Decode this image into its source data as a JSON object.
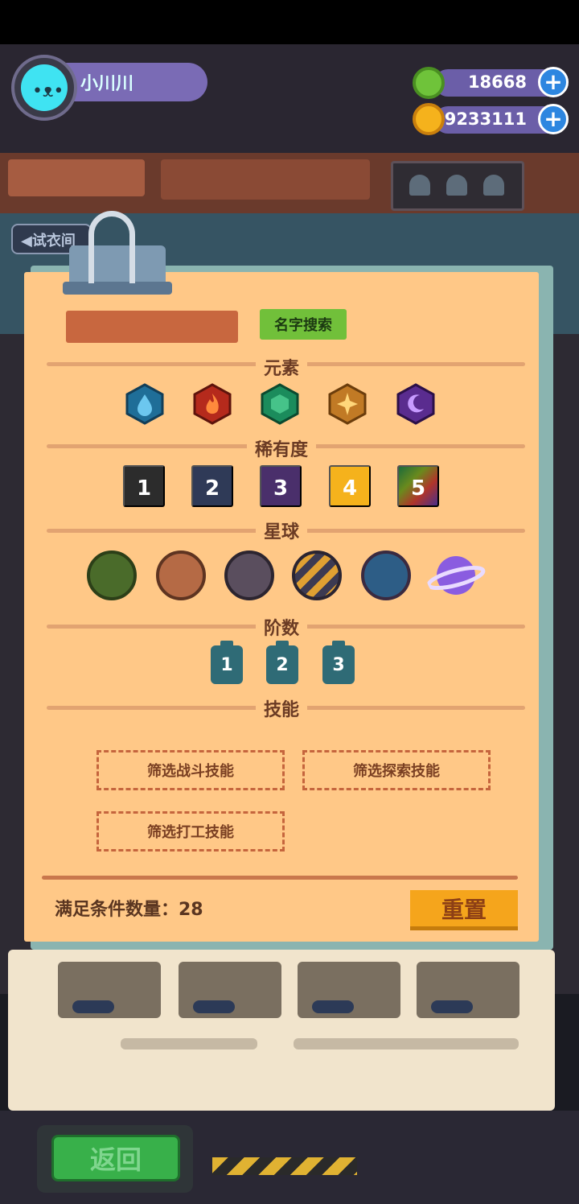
{
  "header": {
    "username": "小川川",
    "currency_green": "18668",
    "currency_gold": "9233111",
    "add_label": "+"
  },
  "trial_tab": {
    "label": "◀试衣间"
  },
  "filter_panel": {
    "search_button": "名字搜索",
    "sections": {
      "element": "元素",
      "rarity": "稀有度",
      "planet": "星球",
      "stage": "阶数",
      "skill": "技能"
    },
    "elements": [
      {
        "icon": "water-icon",
        "color": "#1f6e98"
      },
      {
        "icon": "fire-icon",
        "color": "#b52a1c"
      },
      {
        "icon": "earth-icon",
        "color": "#1b8c5c"
      },
      {
        "icon": "light-icon",
        "color": "#c17a25"
      },
      {
        "icon": "dark-icon",
        "color": "#5a2c8f"
      }
    ],
    "rarities": [
      "1",
      "2",
      "3",
      "4",
      "5"
    ],
    "rarity_colors": [
      "#2c2c2c",
      "#2f3a57",
      "#4a2f6b",
      "#f5b21c",
      "rainbow"
    ],
    "planets": [
      {
        "icon": "planet-green-icon"
      },
      {
        "icon": "planet-cookie-icon"
      },
      {
        "icon": "planet-machine-icon"
      },
      {
        "icon": "planet-striped-icon"
      },
      {
        "icon": "planet-blue-icon"
      },
      {
        "icon": "planet-purple-ringed-icon"
      }
    ],
    "stages": [
      "1",
      "2",
      "3"
    ],
    "skills": {
      "battle": "筛选战斗技能",
      "explore": "筛选探索技能",
      "work": "筛选打工技能"
    },
    "match_count_label": "满足条件数量：28",
    "reset_button": "重置"
  },
  "bottom": {
    "back_button": "返回"
  }
}
